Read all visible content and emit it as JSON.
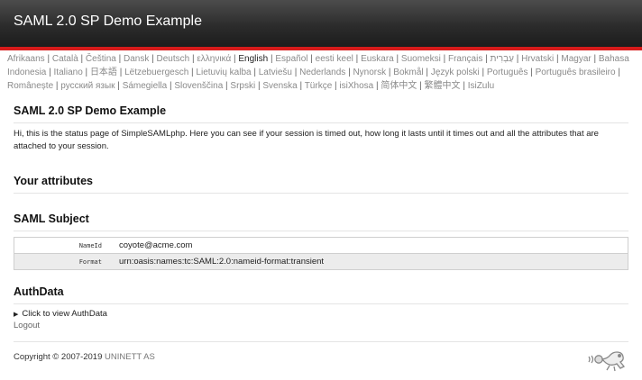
{
  "header": {
    "title": "SAML 2.0 SP Demo Example"
  },
  "languages": [
    {
      "label": "Afrikaans",
      "current": false
    },
    {
      "label": "Català",
      "current": false
    },
    {
      "label": "Čeština",
      "current": false
    },
    {
      "label": "Dansk",
      "current": false
    },
    {
      "label": "Deutsch",
      "current": false
    },
    {
      "label": "ελληνικά",
      "current": false
    },
    {
      "label": "English",
      "current": true
    },
    {
      "label": "Español",
      "current": false
    },
    {
      "label": "eesti keel",
      "current": false
    },
    {
      "label": "Euskara",
      "current": false
    },
    {
      "label": "Suomeksi",
      "current": false
    },
    {
      "label": "Français",
      "current": false
    },
    {
      "label": "עַבְרִית",
      "current": false
    },
    {
      "label": "Hrvatski",
      "current": false
    },
    {
      "label": "Magyar",
      "current": false
    },
    {
      "label": "Bahasa Indonesia",
      "current": false
    },
    {
      "label": "Italiano",
      "current": false
    },
    {
      "label": "日本語",
      "current": false
    },
    {
      "label": "Lëtzebuergesch",
      "current": false
    },
    {
      "label": "Lietuvių kalba",
      "current": false
    },
    {
      "label": "Latviešu",
      "current": false
    },
    {
      "label": "Nederlands",
      "current": false
    },
    {
      "label": "Nynorsk",
      "current": false
    },
    {
      "label": "Bokmål",
      "current": false
    },
    {
      "label": "Język polski",
      "current": false
    },
    {
      "label": "Português",
      "current": false
    },
    {
      "label": "Português brasileiro",
      "current": false
    },
    {
      "label": "Românește",
      "current": false
    },
    {
      "label": "русский язык",
      "current": false
    },
    {
      "label": "Sámegiella",
      "current": false
    },
    {
      "label": "Slovenščina",
      "current": false
    },
    {
      "label": "Srpski",
      "current": false
    },
    {
      "label": "Svenska",
      "current": false
    },
    {
      "label": "Türkçe",
      "current": false
    },
    {
      "label": "isiXhosa",
      "current": false
    },
    {
      "label": "简体中文",
      "current": false
    },
    {
      "label": "繁體中文",
      "current": false
    },
    {
      "label": "IsiZulu",
      "current": false
    }
  ],
  "main": {
    "title": "SAML 2.0 SP Demo Example",
    "intro": "Hi, this is the status page of SimpleSAMLphp. Here you can see if your session is timed out, how long it lasts until it times out and all the attributes that are attached to your session.",
    "attributes_heading": "Your attributes",
    "subject_heading": "SAML Subject",
    "subject_rows": [
      {
        "key": "NameId",
        "value": "coyote@acme.com"
      },
      {
        "key": "Format",
        "value": "urn:oasis:names:tc:SAML:2.0:nameid-format:transient"
      }
    ],
    "authdata_heading": "AuthData",
    "authdata_toggle": "Click to view AuthData",
    "logout_label": "Logout"
  },
  "footer": {
    "copyright": "Copyright © 2007-2019 ",
    "company": "UNINETT AS"
  },
  "icons": {
    "logo": "simplesamlphp-logo-icon",
    "toggle": "triangle-right-icon"
  }
}
